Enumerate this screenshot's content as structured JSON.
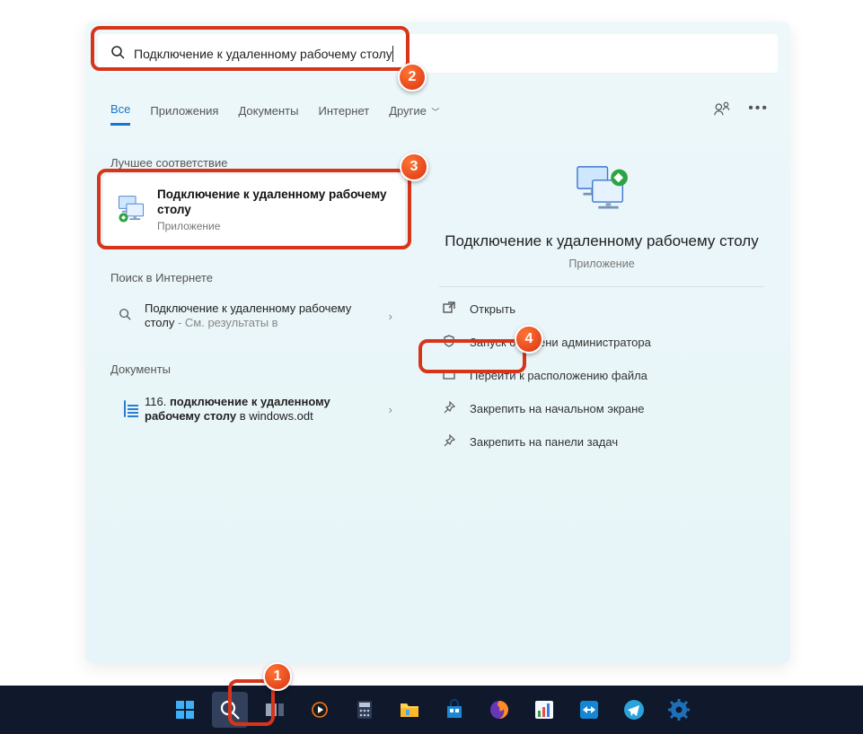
{
  "search": {
    "query": "Подключение к удаленному рабочему столу"
  },
  "tabs": {
    "all": "Все",
    "apps": "Приложения",
    "docs": "Документы",
    "web": "Интернет",
    "more": "Другие"
  },
  "sections": {
    "best_match": "Лучшее соответствие",
    "web": "Поиск в Интернете",
    "documents": "Документы"
  },
  "best_match": {
    "title": "Подключение к удаленному рабочему столу",
    "subtitle": "Приложение"
  },
  "web_result": {
    "text": "Подключение к удаленному рабочему столу",
    "suffix": " - См. результаты в"
  },
  "doc_result": {
    "prefix": "116. ",
    "bold": "подключение к удаленному рабочему столу",
    "suffix": " в windows.odt"
  },
  "detail": {
    "title": "Подключение к удаленному рабочему столу",
    "subtitle": "Приложение",
    "actions": {
      "open": "Открыть",
      "admin": "Запуск от имени администратора",
      "location": "Перейти к расположению файла",
      "pin_start": "Закрепить на начальном экране",
      "pin_taskbar": "Закрепить на панели задач"
    }
  },
  "badges": {
    "1": "1",
    "2": "2",
    "3": "3",
    "4": "4"
  },
  "colors": {
    "annotation": "#d8341a",
    "accent": "#1a73cc",
    "taskbar": "#10182c"
  }
}
